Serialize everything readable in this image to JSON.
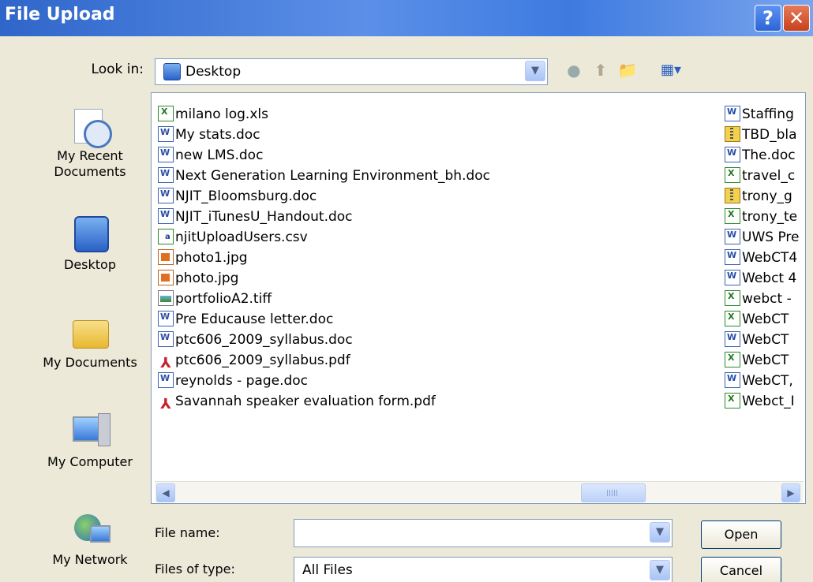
{
  "dialog": {
    "title": "File Upload",
    "help_label": "?",
    "close_label": "✕"
  },
  "lookin": {
    "label": "Look in:",
    "value": "Desktop"
  },
  "places": [
    {
      "label": "My Recent Documents"
    },
    {
      "label": "Desktop"
    },
    {
      "label": "My Documents"
    },
    {
      "label": "My Computer"
    },
    {
      "label": "My Network"
    }
  ],
  "files_left": [
    {
      "name": "milano log.xls",
      "type": "xls"
    },
    {
      "name": "My stats.doc",
      "type": "doc"
    },
    {
      "name": "new LMS.doc",
      "type": "doc"
    },
    {
      "name": "Next Generation Learning Environment_bh.doc",
      "type": "doc"
    },
    {
      "name": "NJIT_Bloomsburg.doc",
      "type": "doc"
    },
    {
      "name": "NJIT_iTunesU_Handout.doc",
      "type": "doc"
    },
    {
      "name": "njitUploadUsers.csv",
      "type": "csv"
    },
    {
      "name": "photo1.jpg",
      "type": "jpg"
    },
    {
      "name": "photo.jpg",
      "type": "jpg"
    },
    {
      "name": "portfolioA2.tiff",
      "type": "tiff"
    },
    {
      "name": "Pre Educause letter.doc",
      "type": "doc"
    },
    {
      "name": "ptc606_2009_syllabus.doc",
      "type": "doc"
    },
    {
      "name": "ptc606_2009_syllabus.pdf",
      "type": "pdf"
    },
    {
      "name": "reynolds - page.doc",
      "type": "doc"
    },
    {
      "name": "Savannah speaker evaluation form.pdf",
      "type": "pdf"
    }
  ],
  "files_right": [
    {
      "name": "Staffing",
      "type": "doc"
    },
    {
      "name": "TBD_bla",
      "type": "zip"
    },
    {
      "name": "The.doc",
      "type": "doc"
    },
    {
      "name": "travel_c",
      "type": "xls"
    },
    {
      "name": "trony_g",
      "type": "zip"
    },
    {
      "name": "trony_te",
      "type": "xls"
    },
    {
      "name": "UWS Pre",
      "type": "doc"
    },
    {
      "name": "WebCT4",
      "type": "doc"
    },
    {
      "name": "Webct 4",
      "type": "doc"
    },
    {
      "name": "webct -",
      "type": "xls"
    },
    {
      "name": "WebCT",
      "type": "xls"
    },
    {
      "name": "WebCT",
      "type": "doc"
    },
    {
      "name": "WebCT",
      "type": "xls"
    },
    {
      "name": "WebCT,",
      "type": "doc"
    },
    {
      "name": "Webct_I",
      "type": "xls"
    }
  ],
  "filename": {
    "label": "File name:",
    "value": ""
  },
  "filetype": {
    "label": "Files of type:",
    "value": "All Files"
  },
  "buttons": {
    "open": "Open",
    "cancel": "Cancel"
  },
  "colors": {
    "titlebar": "#3e7be0",
    "dialog_bg": "#ece9d8",
    "border": "#7f9db9"
  }
}
